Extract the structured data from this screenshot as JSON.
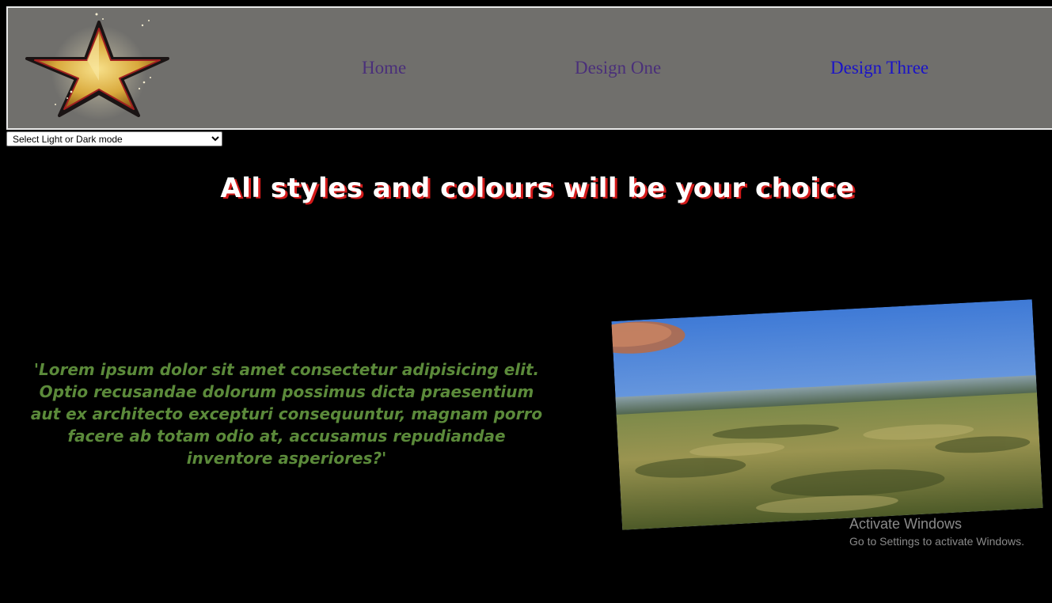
{
  "header": {
    "logo_icon": "gold-star-icon",
    "nav": [
      {
        "label": "Home",
        "color": "#4a2f7a"
      },
      {
        "label": "Design One",
        "color": "#4a2f7a"
      },
      {
        "label": "Design Three",
        "color": "#1a13c8"
      }
    ],
    "background": "#706f6c"
  },
  "mode_select": {
    "selected": "Select Light or Dark mode"
  },
  "main": {
    "heading": "All styles and colours will be your choice",
    "quote": "'Lorem ipsum dolor sit amet consectetur adipisicing elit. Optio recusandae dolorum possimus dicta praesentium aut ex architecto excepturi consequuntur, magnam porro facere ab totam odio at, accusamus repudiandae inventore asperiores?'",
    "photo_subject": "grassland landscape under blue sky"
  },
  "watermark": {
    "title": "Activate Windows",
    "subtitle": "Go to Settings to activate Windows."
  },
  "colors": {
    "page_background": "#000000",
    "heading_text": "#ffffff",
    "heading_shadow": "#d21a1a",
    "quote_text": "#5b8a3a"
  }
}
